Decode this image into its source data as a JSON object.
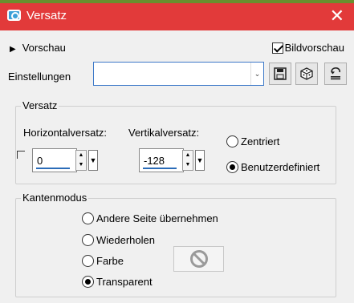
{
  "window": {
    "title": "Versatz",
    "close_glyph": "✕"
  },
  "preview": {
    "toggle_label": "Vorschau",
    "bild_label": "Bildvorschau",
    "bild_checked": true
  },
  "settings": {
    "label": "Einstellungen",
    "value": "",
    "arrow_glyph": "⌄",
    "buttons": [
      "save-icon",
      "preset-dice-icon",
      "reset-icon"
    ]
  },
  "offset": {
    "group_title": "Versatz",
    "horizontal_label": "Horizontalversatz:",
    "horizontal_value": "0",
    "vertical_label": "Vertikalversatz:",
    "vertical_value": "-128",
    "centered_label": "Zentriert",
    "custom_label": "Benutzerdefiniert",
    "selected": "custom"
  },
  "edge_mode": {
    "group_title": "Kantenmodus",
    "options": [
      "Andere Seite übernehmen",
      "Wiederholen",
      "Farbe",
      "Transparent"
    ],
    "selected": "Transparent"
  }
}
